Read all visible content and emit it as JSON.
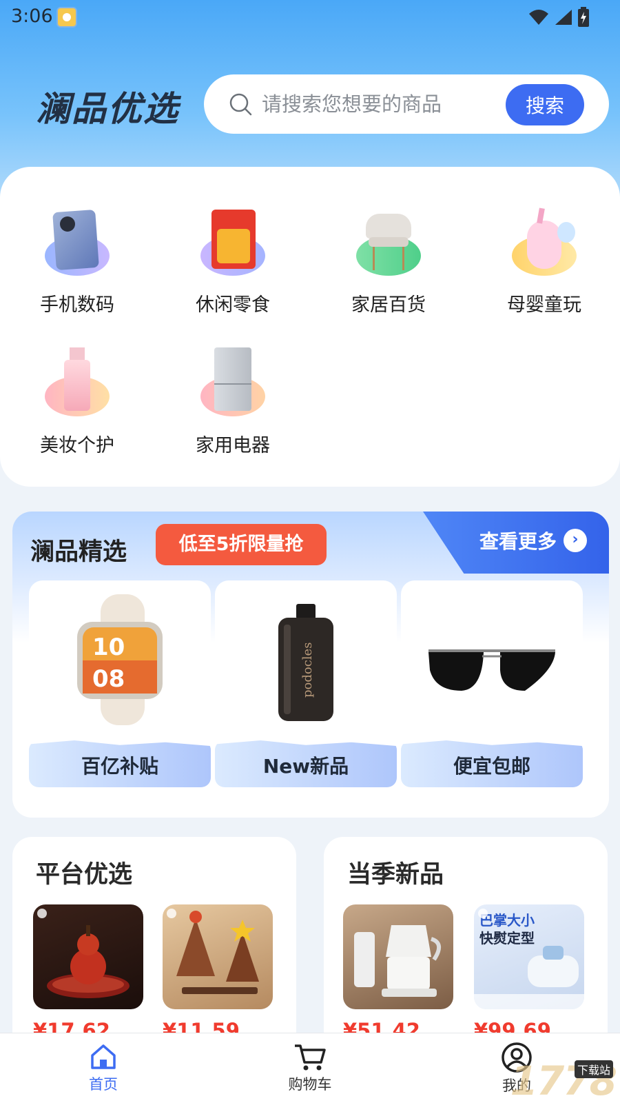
{
  "status_bar": {
    "time": "3:06"
  },
  "header": {
    "brand": "澜品优选",
    "search_placeholder": "请搜索您想要的商品",
    "search_button": "搜索"
  },
  "categories": [
    {
      "label": "手机数码",
      "icon": "phone-icon"
    },
    {
      "label": "休闲零食",
      "icon": "snack-icon"
    },
    {
      "label": "家居百货",
      "icon": "chair-icon"
    },
    {
      "label": "母婴童玩",
      "icon": "unicorn-toy-icon"
    },
    {
      "label": "美妆个护",
      "icon": "cosmetics-bottle-icon"
    },
    {
      "label": "家用电器",
      "icon": "fridge-icon"
    }
  ],
  "featured": {
    "title": "澜品精选",
    "badge": "低至5折限量抢",
    "more": "查看更多",
    "products": [
      {
        "label": "百亿补贴",
        "image": "smartwatch-image"
      },
      {
        "label": "New新品",
        "image": "perfume-bottle-image"
      },
      {
        "label": "便宜包邮",
        "image": "sunglasses-image"
      }
    ]
  },
  "platform_picks": {
    "title": "平台优选",
    "items": [
      {
        "price": "¥17.62",
        "image": "gourd-ornament-image"
      },
      {
        "price": "¥11.59",
        "image": "wooden-tree-ornament-image"
      }
    ]
  },
  "seasonal_new": {
    "title": "当季新品",
    "items": [
      {
        "price": "¥51.42",
        "image": "coffee-maker-image"
      },
      {
        "price": "¥99.69",
        "image": "steam-iron-image",
        "overlay_title": "巴掌大小",
        "overlay_subtitle": "快熨定型"
      }
    ]
  },
  "tab_bar": {
    "tabs": [
      {
        "label": "首页",
        "icon": "home-icon",
        "active": true
      },
      {
        "label": "购物车",
        "icon": "cart-icon",
        "active": false
      },
      {
        "label": "我的",
        "icon": "profile-icon",
        "active": false
      }
    ]
  },
  "watermark": {
    "text": "1778",
    "tag": "下载站"
  },
  "colors": {
    "accent": "#3d6cf2",
    "badge": "#f45a3f",
    "price": "#f03b2e"
  }
}
